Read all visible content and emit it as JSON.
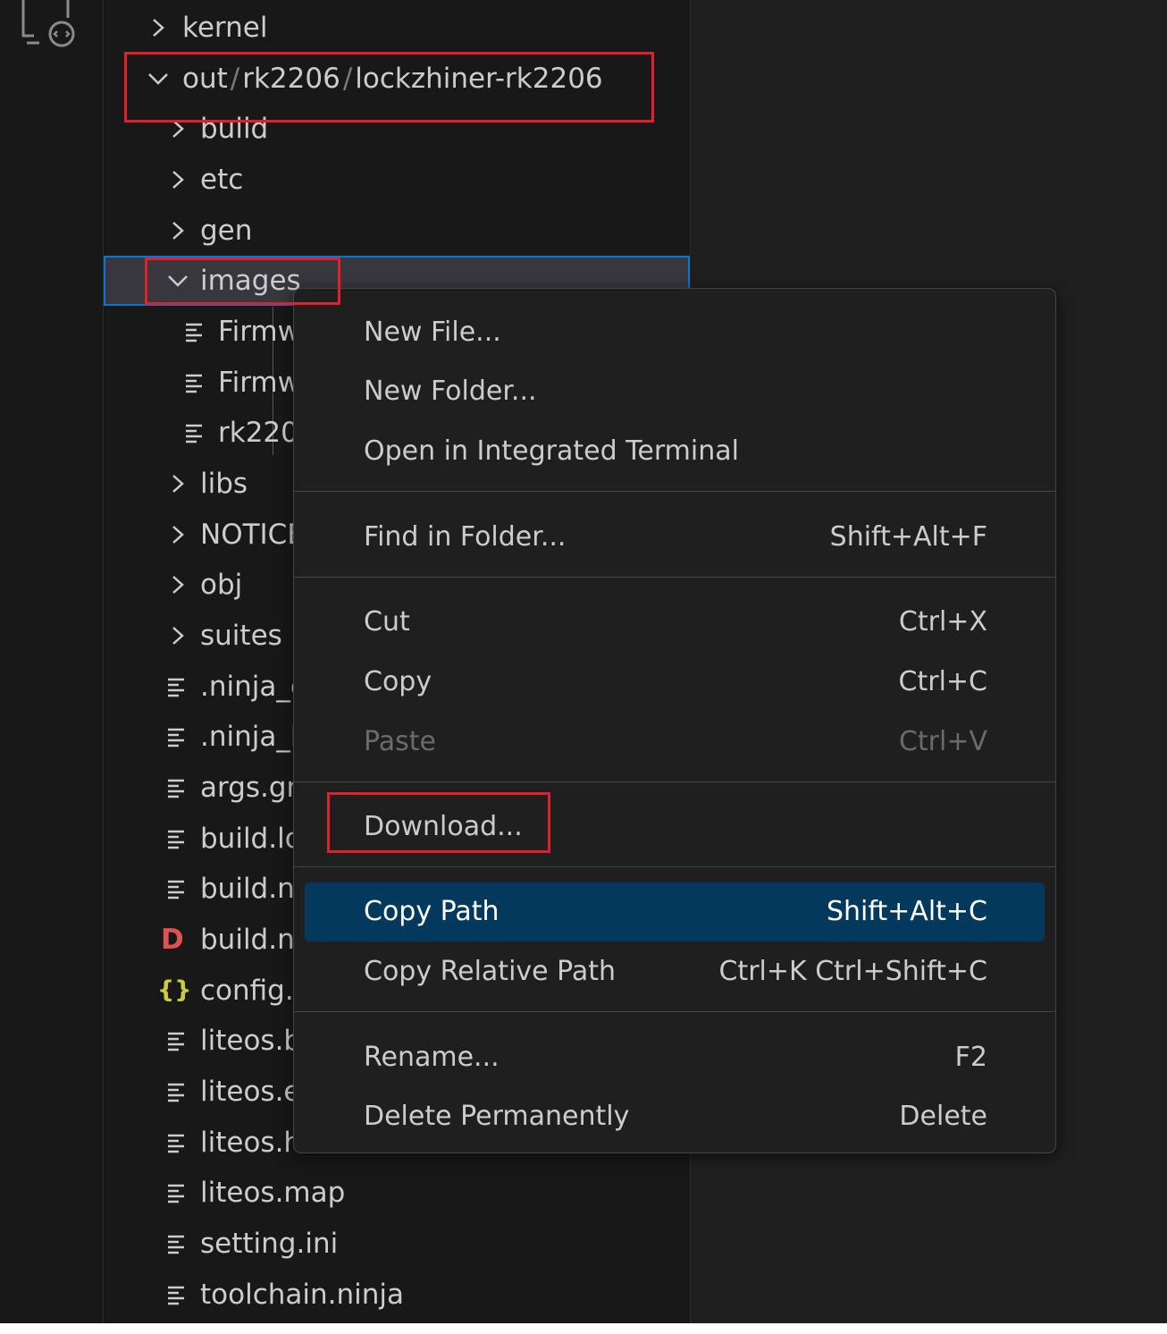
{
  "explorer": {
    "rows": [
      {
        "type": "folder",
        "expanded": false,
        "label": "kernel"
      },
      {
        "type": "folder",
        "expanded": true,
        "label_parts": [
          "out",
          "rk2206",
          "lockzhiner-rk2206"
        ]
      },
      {
        "type": "folder",
        "expanded": false,
        "label": "build"
      },
      {
        "type": "folder",
        "expanded": false,
        "label": "etc"
      },
      {
        "type": "folder",
        "expanded": false,
        "label": "gen"
      },
      {
        "type": "folder",
        "expanded": true,
        "selected": true,
        "label": "images"
      },
      {
        "type": "file",
        "label": "Firmw"
      },
      {
        "type": "file",
        "label": "Firmw"
      },
      {
        "type": "file",
        "label": "rk220"
      },
      {
        "type": "folder",
        "expanded": false,
        "label": "libs"
      },
      {
        "type": "folder",
        "expanded": false,
        "label": "NOTICE"
      },
      {
        "type": "folder",
        "expanded": false,
        "label": "obj"
      },
      {
        "type": "folder",
        "expanded": false,
        "label": "suites"
      },
      {
        "type": "file",
        "label": ".ninja_c"
      },
      {
        "type": "file",
        "label": ".ninja_l"
      },
      {
        "type": "file",
        "label": "args.gn"
      },
      {
        "type": "file",
        "label": "build.lo"
      },
      {
        "type": "file",
        "label": "build.n"
      },
      {
        "type": "file",
        "icon": "d-icon",
        "label": "build.n"
      },
      {
        "type": "file",
        "icon": "json-braces-icon",
        "label": "config.j"
      },
      {
        "type": "file",
        "label": "liteos.b"
      },
      {
        "type": "file",
        "label": "liteos.e"
      },
      {
        "type": "file",
        "label": "liteos.h"
      },
      {
        "type": "file",
        "label": "liteos.map"
      },
      {
        "type": "file",
        "label": "setting.ini"
      },
      {
        "type": "file",
        "label": "toolchain.ninja"
      }
    ]
  },
  "context_menu": {
    "items": [
      {
        "label": "New File...",
        "key": ""
      },
      {
        "label": "New Folder...",
        "key": ""
      },
      {
        "label": "Open in Integrated Terminal",
        "key": ""
      },
      {
        "label": "Find in Folder...",
        "key": "Shift+Alt+F"
      },
      {
        "label": "Cut",
        "key": "Ctrl+X"
      },
      {
        "label": "Copy",
        "key": "Ctrl+C"
      },
      {
        "label": "Paste",
        "key": "Ctrl+V",
        "disabled": true
      },
      {
        "label": "Download...",
        "key": ""
      },
      {
        "label": "Copy Path",
        "key": "Shift+Alt+C",
        "active": true
      },
      {
        "label": "Copy Relative Path",
        "key": "Ctrl+K Ctrl+Shift+C"
      },
      {
        "label": "Rename...",
        "key": "F2"
      },
      {
        "label": "Delete Permanently",
        "key": "Delete"
      }
    ]
  },
  "colors": {
    "accent": "#0078d4",
    "menu_highlight": "#04395e",
    "annotation_red": "#e0202c",
    "d_icon": "#e05252",
    "json_icon": "#cbcb41"
  }
}
